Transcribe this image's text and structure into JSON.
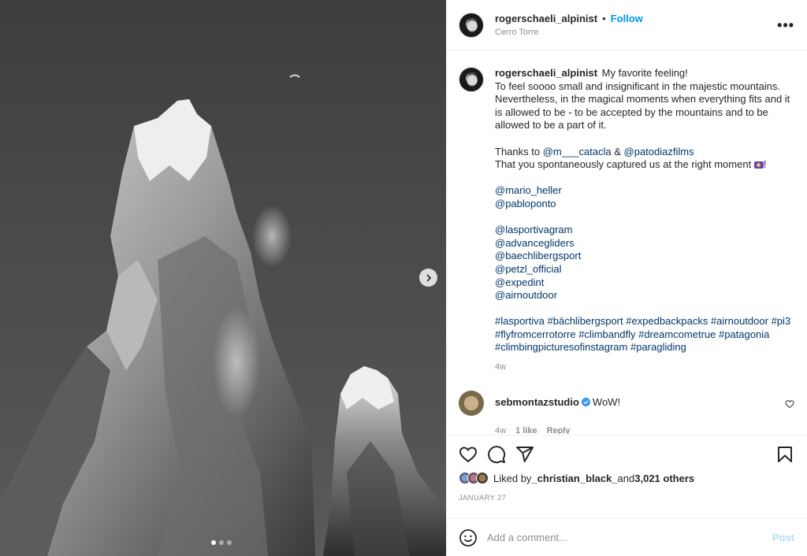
{
  "post": {
    "username": "rogerschaeli_alpinist",
    "follow_label": "Follow",
    "separator": "•",
    "location": "Cerro Torre",
    "more_label": "•••"
  },
  "caption": {
    "username": "rogerschaeli_alpinist",
    "line1": " My favorite feeling!",
    "line2": "To feel soooo small and insignificant in the majestic mountains. Nevertheless, in the magical moments when everything fits and it is allowed to be - to be accepted by the mountains and to be allowed to be a part of it.",
    "thanks_prefix": "Thanks to ",
    "thanks_tag1": "@m___catacla",
    "thanks_and": " & ",
    "thanks_tag2": "@patodiazfilms",
    "captured": "That you spontaneously captured us at the right moment ",
    "captured_end": "!",
    "mentions_group1": [
      "@mario_heller",
      "@pabloponto"
    ],
    "mentions_group2": [
      "@lasportivagram",
      "@advancegliders",
      "@baechlibergsport",
      "@petzl_official",
      "@expedint",
      "@airnoutdoor"
    ],
    "hashtags": [
      "#lasportiva",
      "#bächlibergsport",
      "#expedbackpacks",
      "#airnoutdoor",
      "#pi3",
      "#flyfromcerrotorre",
      "#climbandfly",
      "#dreamcometrue",
      "#patagonia",
      "#climbingpicturesofinstagram",
      "#paragliding"
    ],
    "time": "4w"
  },
  "comment": {
    "username": "sebmontazstudio",
    "text": "WoW!",
    "time": "4w",
    "likes": "1 like",
    "reply": "Reply"
  },
  "likes": {
    "prefix": "Liked by ",
    "user": "_christian_black_",
    "and": " and ",
    "others": "3,021 others"
  },
  "date": "JANUARY 27",
  "add_comment": {
    "placeholder": "Add a comment...",
    "post_label": "Post"
  },
  "carousel": {
    "count": 3,
    "active": 0
  },
  "icons": [
    "next-arrow-icon",
    "heart-icon",
    "comment-icon",
    "share-icon",
    "bookmark-icon",
    "smile-icon",
    "verified-icon"
  ],
  "colors": {
    "link": "#00376b",
    "follow": "#0095f6",
    "post_disabled": "#b2dffc",
    "meta": "#8e8e8e",
    "verified": "#3897f0"
  }
}
